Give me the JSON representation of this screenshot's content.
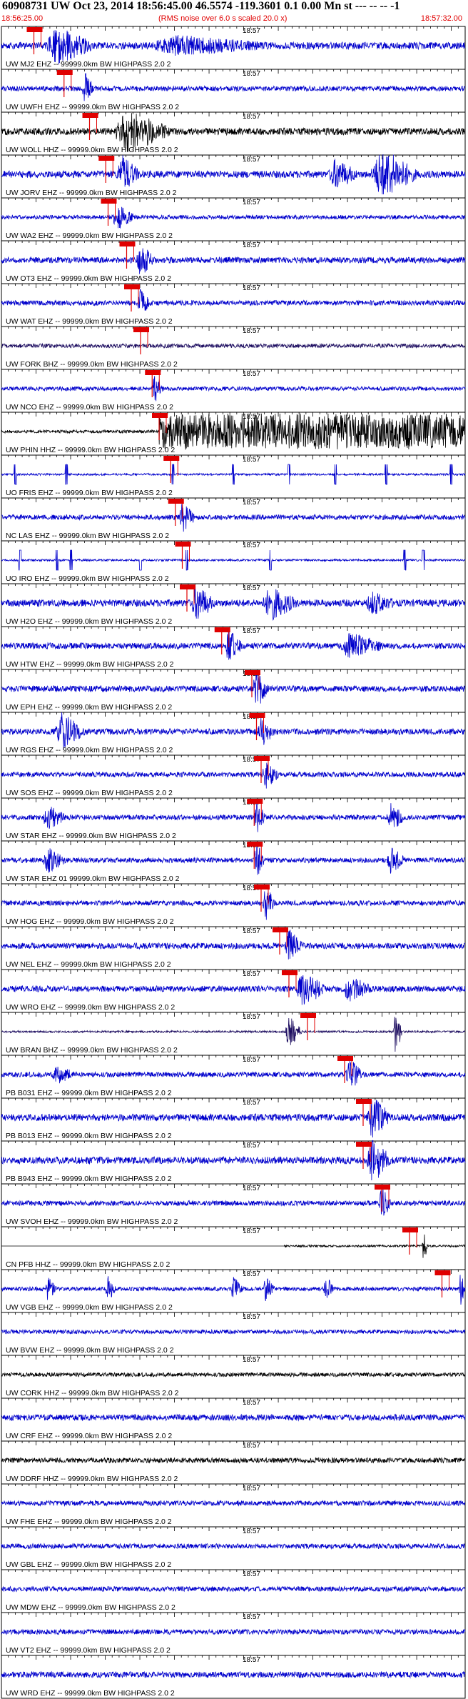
{
  "header": {
    "title": "60908731 UW Oct 23, 2014 18:56:45.00   46.5574 -119.3601  0.1 0.00 Mn st --- -- --  -1",
    "start_time": "18:56:25.00",
    "rms_note": "(RMS noise over 6.0 s scaled 20.0 x)",
    "end_time": "18:57:32.00"
  },
  "chart_data": {
    "type": "seismogram",
    "time_start": "18:56:25.00",
    "time_end": "18:57:32.00",
    "center_tick_label": "18:57",
    "colors": {
      "trace_blue": "#0000cc",
      "trace_black": "#000000",
      "trace_navy": "#1a0a5e",
      "pick": "#e00000"
    },
    "traces": [
      {
        "label": "UW MJ2 EHZ -- 99999.0km BW  HIGHPASS  2.0  2",
        "pick": 0.07,
        "color": "blue",
        "amp": 0.35,
        "bursts": [
          [
            0.12,
            0.08,
            0.9
          ],
          [
            0.38,
            0.2,
            0.4
          ]
        ]
      },
      {
        "label": "UW UWFH EHZ -- 99999.0km BW  HIGHPASS  2.0  2",
        "pick": 0.135,
        "color": "blue",
        "amp": 0.25,
        "bursts": [
          [
            0.18,
            0.02,
            0.9
          ]
        ]
      },
      {
        "label": "UW WOLL HHZ -- 99999.0km BW  HIGHPASS  2.0  2",
        "pick": 0.19,
        "color": "black",
        "amp": 0.35,
        "bursts": [
          [
            0.27,
            0.1,
            1.0
          ]
        ]
      },
      {
        "label": "UW JORV EHZ -- 99999.0km BW  HIGHPASS  2.0  2",
        "pick": 0.225,
        "color": "blue",
        "amp": 0.35,
        "bursts": [
          [
            0.26,
            0.04,
            0.9
          ],
          [
            0.82,
            0.08,
            1.3
          ],
          [
            0.72,
            0.05,
            0.7
          ]
        ]
      },
      {
        "label": "UW WA2 EHZ -- 99999.0km BW  HIGHPASS  2.0  2",
        "pick": 0.23,
        "color": "blue",
        "amp": 0.2,
        "bursts": [
          [
            0.25,
            0.04,
            0.6
          ]
        ]
      },
      {
        "label": "UW OT3 EHZ -- 99999.0km BW  HIGHPASS  2.0  2",
        "pick": 0.27,
        "color": "blue",
        "amp": 0.3,
        "bursts": [
          [
            0.3,
            0.03,
            0.8
          ]
        ]
      },
      {
        "label": "UW WAT EHZ -- 99999.0km BW  HIGHPASS  2.0  2",
        "pick": 0.28,
        "color": "blue",
        "amp": 0.25,
        "bursts": [
          [
            0.3,
            0.02,
            0.7
          ]
        ]
      },
      {
        "label": "UW FORK BHZ -- 99999.0km BW  HIGHPASS  2.0  2",
        "pick": 0.3,
        "color": "navy",
        "amp": 0.2,
        "bursts": []
      },
      {
        "label": "UW NCO EHZ -- 99999.0km BW  HIGHPASS  2.0  2",
        "pick": 0.325,
        "color": "blue",
        "amp": 0.2,
        "bursts": [
          [
            0.33,
            0.02,
            0.8
          ]
        ]
      },
      {
        "label": "UW PHIN HHZ -- 99999.0km BW  HIGHPASS  2.0  2",
        "pick": 0.34,
        "color": "black",
        "amp": 0.15,
        "sat_from": 0.34,
        "bursts": []
      },
      {
        "label": "UO FRIS EHZ -- 99999.0km BW  HIGHPASS  2.0  2",
        "pick": 0.365,
        "color": "blue",
        "amp": 0.1,
        "spikes": [
          0.03,
          0.14,
          0.37,
          0.5,
          0.62,
          0.72,
          0.83,
          0.97
        ],
        "bursts": []
      },
      {
        "label": "NC LAS EHZ -- 99999.0km BW  HIGHPASS  2.0  2",
        "pick": 0.375,
        "color": "blue",
        "amp": 0.25,
        "bursts": [
          [
            0.39,
            0.03,
            0.7
          ]
        ]
      },
      {
        "label": "UO IRO EHZ -- 99999.0km BW  HIGHPASS  2.0  2",
        "pick": 0.39,
        "color": "blue",
        "amp": 0.1,
        "spikes": [
          0.04,
          0.12,
          0.15,
          0.3,
          0.4,
          0.58,
          0.87,
          0.91
        ],
        "bursts": []
      },
      {
        "label": "UW H2O EHZ -- 99999.0km BW  HIGHPASS  2.0  2",
        "pick": 0.4,
        "color": "blue",
        "amp": 0.35,
        "bursts": [
          [
            0.42,
            0.04,
            0.9
          ],
          [
            0.58,
            0.06,
            0.8
          ],
          [
            0.8,
            0.05,
            0.5
          ]
        ]
      },
      {
        "label": "UW HTW EHZ -- 99999.0km BW  HIGHPASS  2.0  2",
        "pick": 0.475,
        "color": "blue",
        "amp": 0.3,
        "bursts": [
          [
            0.49,
            0.03,
            0.8
          ],
          [
            0.75,
            0.08,
            0.6
          ]
        ]
      },
      {
        "label": "UW EPH EHZ -- 99999.0km BW  HIGHPASS  2.0  2",
        "pick": 0.54,
        "color": "blue",
        "amp": 0.3,
        "bursts": [
          [
            0.55,
            0.03,
            0.9
          ]
        ]
      },
      {
        "label": "UW RGS EHZ -- 99999.0km BW  HIGHPASS  2.0  2",
        "pick": 0.55,
        "color": "blue",
        "amp": 0.3,
        "bursts": [
          [
            0.13,
            0.05,
            0.9
          ],
          [
            0.56,
            0.03,
            0.7
          ]
        ]
      },
      {
        "label": "UW SOS EHZ -- 99999.0km BW  HIGHPASS  2.0  2",
        "pick": 0.56,
        "color": "blue",
        "amp": 0.25,
        "bursts": [
          [
            0.57,
            0.03,
            0.7
          ]
        ]
      },
      {
        "label": "UW STAR EHZ -- 99999.0km BW  HIGHPASS  2.0  2",
        "pick": 0.545,
        "color": "blue",
        "amp": 0.25,
        "bursts": [
          [
            0.1,
            0.04,
            0.6
          ],
          [
            0.55,
            0.02,
            0.8
          ],
          [
            0.84,
            0.03,
            0.7
          ]
        ]
      },
      {
        "label": "UW STAR EHZ 01 99999.0km BW  HIGHPASS  2.0  2",
        "pick": 0.545,
        "color": "blue",
        "amp": 0.25,
        "bursts": [
          [
            0.1,
            0.04,
            0.6
          ],
          [
            0.55,
            0.02,
            0.9
          ],
          [
            0.84,
            0.03,
            0.7
          ]
        ]
      },
      {
        "label": "UW HOG EHZ -- 99999.0km BW  HIGHPASS  2.0  2",
        "pick": 0.56,
        "color": "blue",
        "amp": 0.25,
        "bursts": [
          [
            0.57,
            0.02,
            0.9
          ]
        ]
      },
      {
        "label": "UW NEL EHZ -- 99999.0km BW  HIGHPASS  2.0  2",
        "pick": 0.6,
        "color": "blue",
        "amp": 0.3,
        "bursts": [
          [
            0.62,
            0.03,
            0.8
          ]
        ]
      },
      {
        "label": "UW WRO EHZ -- 99999.0km BW  HIGHPASS  2.0  2",
        "pick": 0.62,
        "color": "blue",
        "amp": 0.3,
        "bursts": [
          [
            0.65,
            0.05,
            0.9
          ],
          [
            0.75,
            0.05,
            0.6
          ]
        ]
      },
      {
        "label": "UW BRAN BHZ -- 99999.0km BW  HIGHPASS  2.0  2",
        "pick": 0.66,
        "color": "navy",
        "amp": 0.1,
        "bursts": [
          [
            0.62,
            0.03,
            0.9
          ],
          [
            0.85,
            0.015,
            1.4
          ]
        ]
      },
      {
        "label": "PB B031 EHZ -- 99999.0km BW  HIGHPASS  2.0  2",
        "pick": 0.74,
        "color": "blue",
        "amp": 0.25,
        "bursts": [
          [
            0.75,
            0.03,
            0.8
          ],
          [
            0.12,
            0.04,
            0.4
          ]
        ]
      },
      {
        "label": "PB B013 EHZ -- 99999.0km BW  HIGHPASS  2.0  2",
        "pick": 0.78,
        "color": "blue",
        "amp": 0.35,
        "bursts": [
          [
            0.8,
            0.04,
            1.1
          ]
        ]
      },
      {
        "label": "PB B943 EHZ -- 99999.0km BW  HIGHPASS  2.0  2",
        "pick": 0.78,
        "color": "blue",
        "amp": 0.35,
        "bursts": [
          [
            0.8,
            0.04,
            1.2
          ]
        ]
      },
      {
        "label": "UW SVOH EHZ -- 99999.0km BW  HIGHPASS  2.0  2",
        "pick": 0.82,
        "color": "blue",
        "amp": 0.25,
        "bursts": [
          [
            0.82,
            0.02,
            0.9
          ]
        ]
      },
      {
        "label": "CN PFB HHZ -- 99999.0km BW  HIGHPASS  2.0  2",
        "pick": 0.88,
        "color": "black",
        "amp": 0.05,
        "flat_before": 0.61,
        "bursts": [
          [
            0.91,
            0.01,
            0.9
          ]
        ]
      },
      {
        "label": "UW VGB EHZ -- 99999.0km BW  HIGHPASS  2.0  2",
        "pick": 0.95,
        "color": "blue",
        "amp": 0.2,
        "bursts": [
          [
            0.1,
            0.02,
            0.6
          ],
          [
            0.23,
            0.02,
            0.6
          ],
          [
            0.5,
            0.02,
            0.6
          ],
          [
            0.57,
            0.02,
            0.6
          ],
          [
            0.7,
            0.02,
            0.6
          ],
          [
            0.99,
            0.01,
            0.9
          ]
        ]
      },
      {
        "label": "UW BVW EHZ -- 99999.0km BW  HIGHPASS  2.0  2",
        "pick": null,
        "color": "blue",
        "amp": 0.2,
        "bursts": []
      },
      {
        "label": "UW CORK HHZ -- 99999.0km BW  HIGHPASS  2.0  2",
        "pick": null,
        "color": "black",
        "amp": 0.2,
        "bursts": []
      },
      {
        "label": "UW CRF EHZ -- 99999.0km BW  HIGHPASS  2.0  2",
        "pick": null,
        "color": "blue",
        "amp": 0.3,
        "bursts": []
      },
      {
        "label": "UW DDRF HHZ -- 99999.0km BW  HIGHPASS  2.0  2",
        "pick": null,
        "color": "black",
        "amp": 0.25,
        "bursts": []
      },
      {
        "label": "UW FHE EHZ -- 99999.0km BW  HIGHPASS  2.0  2",
        "pick": null,
        "color": "blue",
        "amp": 0.25,
        "bursts": []
      },
      {
        "label": "UW GBL EHZ -- 99999.0km BW  HIGHPASS  2.0  2",
        "pick": null,
        "color": "blue",
        "amp": 0.25,
        "bursts": []
      },
      {
        "label": "UW MDW EHZ -- 99999.0km BW  HIGHPASS  2.0  2",
        "pick": null,
        "color": "blue",
        "amp": 0.25,
        "bursts": []
      },
      {
        "label": "UW VT2 EHZ -- 99999.0km BW  HIGHPASS  2.0  2",
        "pick": null,
        "color": "blue",
        "amp": 0.25,
        "bursts": []
      },
      {
        "label": "UW WRD EHZ -- 99999.0km BW  HIGHPASS  2.0  2",
        "pick": null,
        "color": "blue",
        "amp": 0.3,
        "bursts": []
      }
    ]
  }
}
